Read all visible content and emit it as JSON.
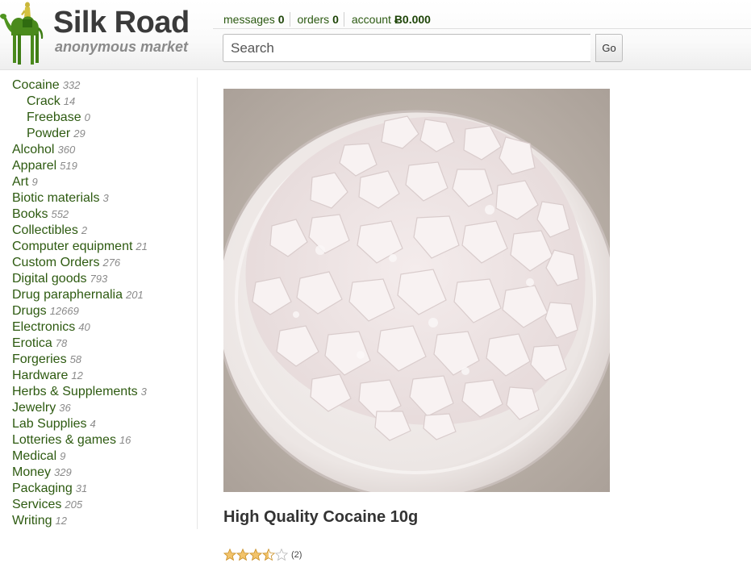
{
  "brand": {
    "title": "Silk Road",
    "subtitle": "anonymous market"
  },
  "topnav": {
    "messages_label": "messages",
    "messages_count": "0",
    "orders_label": "orders",
    "orders_count": "0",
    "account_label": "account",
    "account_balance": "Ƀ0.000"
  },
  "search": {
    "placeholder": "Search",
    "value": "",
    "button_label": "Go"
  },
  "sidebar": {
    "categories": [
      {
        "label": "Cocaine",
        "count": "332"
      },
      {
        "label": "Crack",
        "count": "14"
      },
      {
        "label": "Freebase",
        "count": "0"
      },
      {
        "label": "Powder",
        "count": "29"
      },
      {
        "label": "Alcohol",
        "count": "360"
      },
      {
        "label": "Apparel",
        "count": "519"
      },
      {
        "label": "Art",
        "count": "9"
      },
      {
        "label": "Biotic materials",
        "count": "3"
      },
      {
        "label": "Books",
        "count": "552"
      },
      {
        "label": "Collectibles",
        "count": "2"
      },
      {
        "label": "Computer equipment",
        "count": "21"
      },
      {
        "label": "Custom Orders",
        "count": "276"
      },
      {
        "label": "Digital goods",
        "count": "793"
      },
      {
        "label": "Drug paraphernalia",
        "count": "201"
      },
      {
        "label": "Drugs",
        "count": "12669"
      },
      {
        "label": "Electronics",
        "count": "40"
      },
      {
        "label": "Erotica",
        "count": "78"
      },
      {
        "label": "Forgeries",
        "count": "58"
      },
      {
        "label": "Hardware",
        "count": "12"
      },
      {
        "label": "Herbs & Supplements",
        "count": "3"
      },
      {
        "label": "Jewelry",
        "count": "36"
      },
      {
        "label": "Lab Supplies",
        "count": "4"
      },
      {
        "label": "Lotteries & games",
        "count": "16"
      },
      {
        "label": "Medical",
        "count": "9"
      },
      {
        "label": "Money",
        "count": "329"
      },
      {
        "label": "Packaging",
        "count": "31"
      },
      {
        "label": "Services",
        "count": "205"
      },
      {
        "label": "Writing",
        "count": "12"
      }
    ]
  },
  "product": {
    "title": "High Quality Cocaine 10g",
    "rating": {
      "value": 3.5,
      "max": 5,
      "count_text": "(2)"
    }
  },
  "colors": {
    "link": "#2d5a10",
    "count_gray": "#8a8a8a",
    "star": "#e3a83a"
  }
}
